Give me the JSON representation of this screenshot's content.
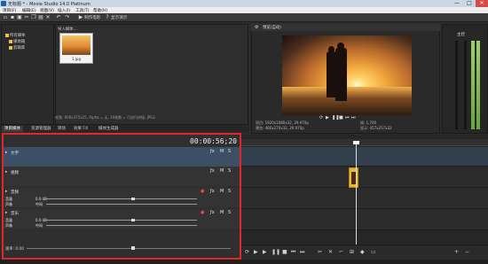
{
  "window": {
    "title": "无标题 * - Movie Studio 14.0 Platinum",
    "buttons": [
      "—",
      "□",
      "✕"
    ]
  },
  "menu": {
    "items": [
      "项目(F)",
      "编辑(E)",
      "视图(V)",
      "插入(I)",
      "工具(T)",
      "帮助(H)"
    ]
  },
  "toolbar": {
    "make_movie_label": "制作电影",
    "show_me_how_label": "显示演示"
  },
  "explorer": {
    "tree_items": [
      "所有媒体",
      "媒体箱",
      "剪辑库"
    ],
    "toolbar_label": "导入媒体...",
    "thumbnail_name": "1.jpg",
    "status": "视频: 600x375x25, Alpha = 无, 10帧数 = 可进行拼接, JPEG"
  },
  "left_tabs": [
    "项目媒体",
    "资源管理器",
    "转场",
    "效果 FX",
    "媒体生成器"
  ],
  "preview": {
    "toolbar_label": "预览(自动)",
    "info_lines": [
      "项目: 1920x1080x32, 29.970p",
      "预览: 480x270x32, 29.970p",
      "帧: 1,700",
      "显示: 457x257x32"
    ]
  },
  "meter": {
    "label": "主控"
  },
  "timeline": {
    "timecode": "00:00:56;20",
    "tracks": [
      {
        "name": "文字",
        "type": "video"
      },
      {
        "name": "视频",
        "type": "video"
      },
      {
        "name": "音频",
        "type": "audio",
        "volume": "0.0 dB",
        "pan": "中间"
      },
      {
        "name": "音乐",
        "type": "audio",
        "volume": "0.0 dB",
        "pan": "中间"
      }
    ],
    "rate_label": "速率: 0.00"
  }
}
